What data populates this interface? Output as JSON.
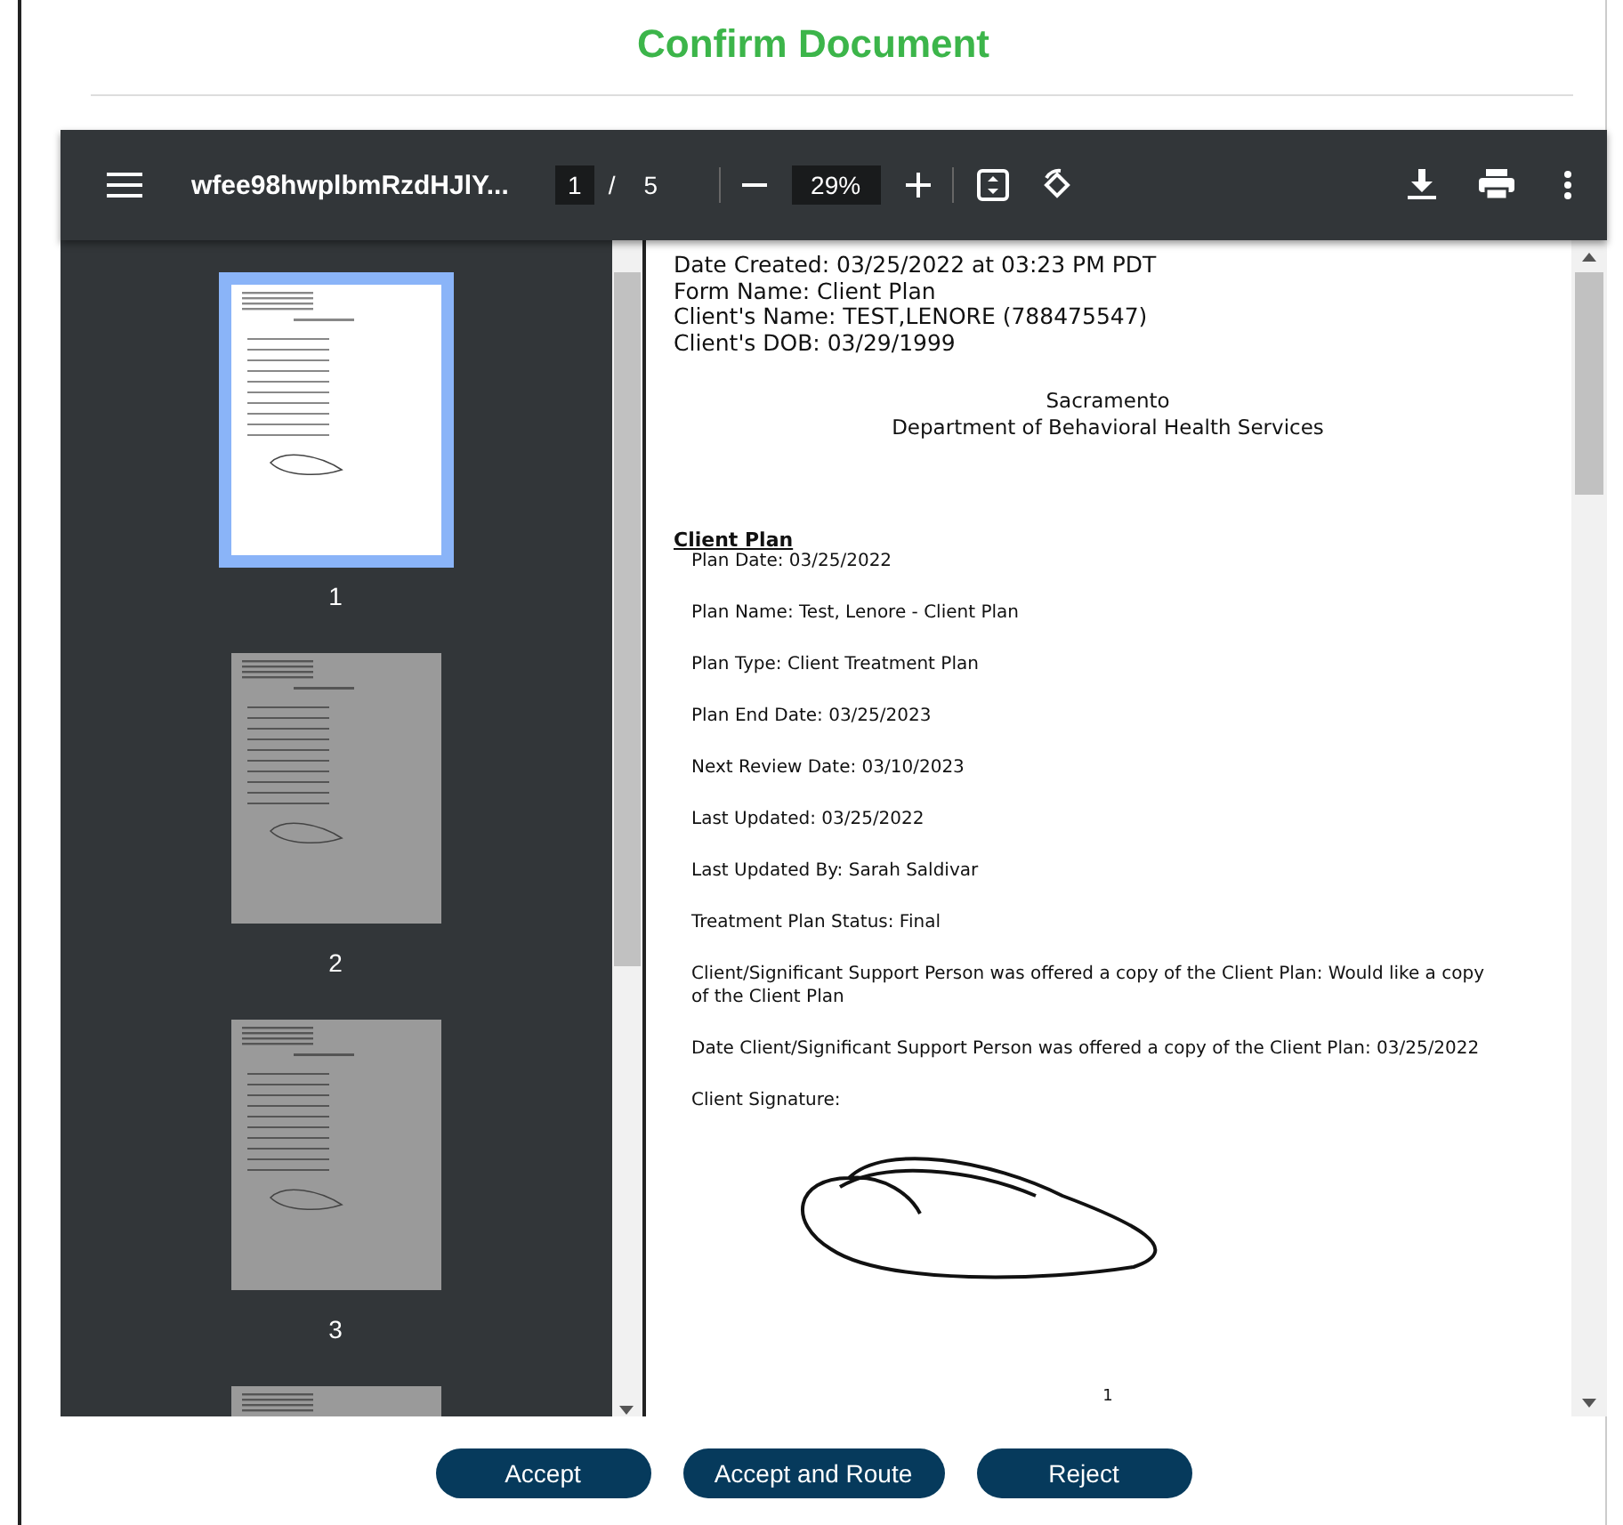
{
  "title": "Confirm Document",
  "viewer": {
    "file_name": "wfee98hwplbmRzdHJlY...",
    "page_current": "1",
    "page_separator": "/",
    "page_total": "5",
    "zoom": "29%",
    "thumbnails": [
      {
        "label": "1",
        "selected": true
      },
      {
        "label": "2",
        "selected": false
      },
      {
        "label": "3",
        "selected": false
      },
      {
        "selected": false
      }
    ],
    "document": {
      "header_lines": [
        "Date Created: 03/25/2022 at 03:23 PM PDT",
        "Form Name: Client Plan",
        "Client's Name: TEST,LENORE (788475547)",
        "Client's DOB: 03/29/1999"
      ],
      "org_lines": [
        "Sacramento",
        "Department of Behavioral Health Services"
      ],
      "section_title": "Client Plan",
      "fields": [
        "Plan Date: 03/25/2022",
        "Plan Name: Test, Lenore - Client Plan",
        "Plan Type: Client Treatment Plan",
        "Plan End Date: 03/25/2023",
        "Next Review Date: 03/10/2023",
        "Last Updated: 03/25/2022",
        "Last Updated By: Sarah Saldivar",
        "Treatment Plan Status: Final",
        "Client/Significant Support Person was offered a copy of the Client Plan: Would like a copy of the Client Plan",
        "Date Client/Significant Support Person was offered a copy of the Client Plan: 03/25/2022",
        "Client Signature:"
      ],
      "page_number": "1"
    }
  },
  "buttons": [
    "Accept",
    "Accept and Route",
    "Reject"
  ]
}
